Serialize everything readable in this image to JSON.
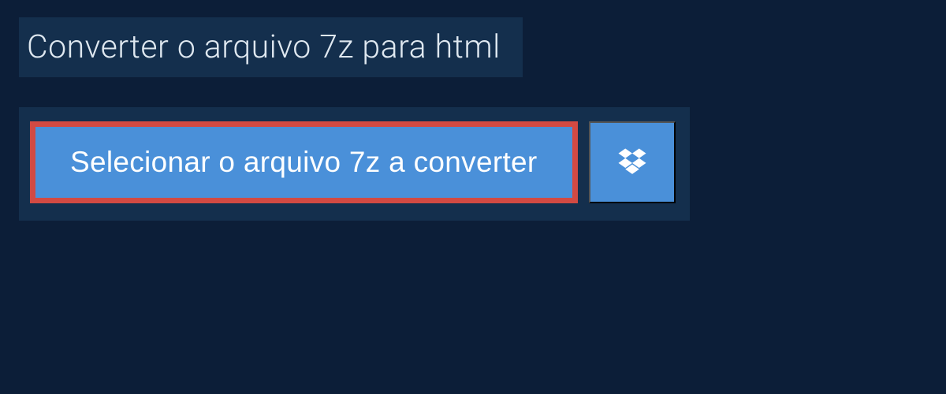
{
  "header": {
    "title": "Converter o arquivo 7z para html"
  },
  "buttons": {
    "select_file_label": "Selecionar o arquivo 7z a converter"
  },
  "colors": {
    "background": "#0c1e38",
    "panel": "#142f4d",
    "button": "#4a90d9",
    "highlight_border": "#d24a43",
    "text_light": "#dfe8f0",
    "text_white": "#ffffff"
  }
}
